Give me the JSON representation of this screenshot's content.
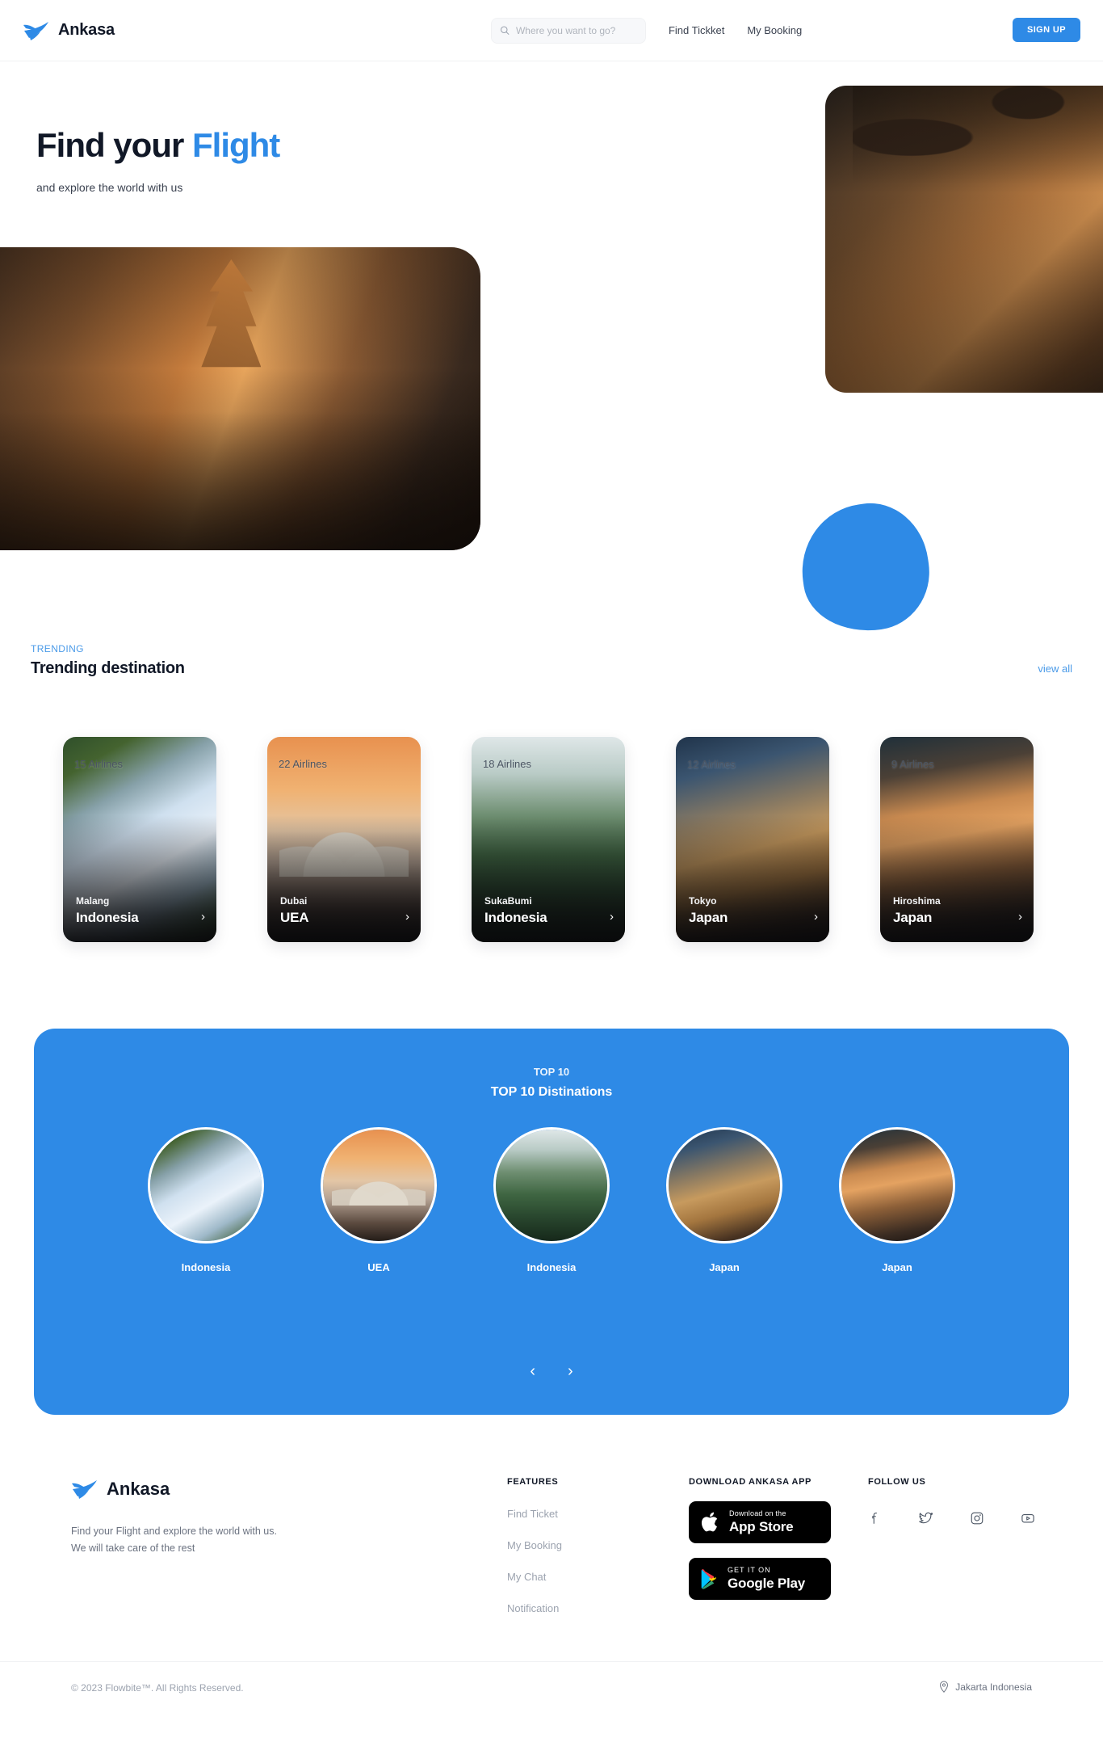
{
  "header": {
    "brand": "Ankasa",
    "logo_icon": "paper-plane-logo-icon",
    "search": {
      "placeholder": "Where you want to go?",
      "value": "",
      "icon": "search-icon"
    },
    "nav": [
      {
        "label": "Find Tickket"
      },
      {
        "label": "My Booking"
      }
    ],
    "signup_label": "SIGN UP"
  },
  "hero": {
    "title_lead": "Find your ",
    "title_accent": "Flight",
    "subtitle": "and explore the world with us"
  },
  "trending": {
    "eyebrow": "TRENDING",
    "title": "Trending destination",
    "view_all": "view all",
    "cards": [
      {
        "airlines": "15 Airlines",
        "city": "Malang",
        "country": "Indonesia",
        "arrow": "›",
        "photo": "ph-malang"
      },
      {
        "airlines": "22 Airlines",
        "city": "Dubai",
        "country": "UEA",
        "arrow": "›",
        "photo": "ph-dubai"
      },
      {
        "airlines": "18 Airlines",
        "city": "SukaBumi",
        "country": "Indonesia",
        "arrow": "›",
        "photo": "ph-suka"
      },
      {
        "airlines": "12 Airlines",
        "city": "Tokyo",
        "country": "Japan",
        "arrow": "›",
        "photo": "ph-tokyo"
      },
      {
        "airlines": "9 Airlines",
        "city": "Hiroshima",
        "country": "Japan",
        "arrow": "›",
        "photo": "ph-hiro"
      }
    ]
  },
  "top10": {
    "eyebrow": "TOP 10",
    "title": "TOP 10 Distinations",
    "accent_color": "#2e8ae6",
    "items": [
      {
        "label": "Indonesia",
        "photo": "ph-malang"
      },
      {
        "label": "UEA",
        "photo": "ph-dubai"
      },
      {
        "label": "Indonesia",
        "photo": "ph-suka"
      },
      {
        "label": "Japan",
        "photo": "ph-tokyo"
      },
      {
        "label": "Japan",
        "photo": "ph-hiro"
      }
    ],
    "prev_icon": "chevron-left-icon",
    "next_icon": "chevron-right-icon",
    "prev_glyph": "‹",
    "next_glyph": "›"
  },
  "footer": {
    "brand": "Ankasa",
    "description": "Find your Flight and explore the world with us. We will take care of the rest",
    "features": {
      "heading": "FEATURES",
      "items": [
        {
          "label": "Find Ticket"
        },
        {
          "label": "My Booking"
        },
        {
          "label": "My Chat"
        },
        {
          "label": "Notification"
        }
      ]
    },
    "download": {
      "heading": "DOWNLOAD ANKASA APP",
      "appstore": {
        "small": "Download on the",
        "big": "App Store",
        "icon": "apple-icon"
      },
      "googleplay": {
        "small": "GET IT ON",
        "big": "Google Play",
        "icon": "google-play-icon"
      }
    },
    "follow": {
      "heading": "FOLLOW US",
      "icons": [
        {
          "name": "facebook-icon"
        },
        {
          "name": "twitter-icon"
        },
        {
          "name": "instagram-icon"
        },
        {
          "name": "youtube-icon"
        }
      ]
    },
    "copyright": "© 2023 Flowbite™. All Rights Reserved.",
    "location": "Jakarta Indonesia",
    "location_icon": "map-pin-icon"
  }
}
